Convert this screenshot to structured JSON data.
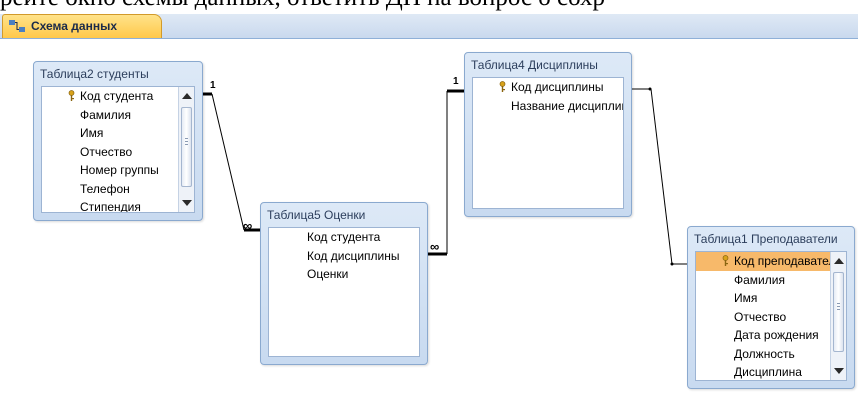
{
  "background_text": "рейте окно схемы данных, ответить ДП на вопрос о сохр",
  "tab": {
    "label": "Схема данных",
    "icon": "relationships-icon",
    "color": "#ffc84a"
  },
  "tables": [
    {
      "title": "Таблица2 студенты",
      "fields": [
        "Код студента",
        "Фамилия",
        "Имя",
        "Отчество",
        "Номер группы",
        "Телефон",
        "Стипендия"
      ],
      "key_field_index": 0
    },
    {
      "title": "Таблица5 Оценки",
      "fields": [
        "Код студента",
        "Код дисциплины",
        "Оценки"
      ]
    },
    {
      "title": "Таблица4 Дисциплины",
      "fields": [
        "Код дисциплины",
        "Название дисциплины"
      ],
      "key_field_index": 0
    },
    {
      "title": "Таблица1 Преподаватели",
      "fields": [
        "Код преподавателя",
        "Фамилия",
        "Имя",
        "Отчество",
        "Дата рождения",
        "Должность",
        "Дисциплина"
      ],
      "key_field_index": 0,
      "selected_field_index": 0
    }
  ],
  "relationships": [
    {
      "from": "Таблица2 студенты",
      "to": "Таблица5 Оценки",
      "one_label": "1",
      "many_label": "∞"
    },
    {
      "from": "Таблица4 Дисциплины",
      "to": "Таблица5 Оценки",
      "one_label": "1",
      "many_label": "∞"
    },
    {
      "from": "Таблица4 Дисциплины",
      "to": "Таблица1 Преподаватели"
    }
  ],
  "colors": {
    "selected_field": "#f7b96a",
    "table_header": "#c8daf0",
    "tab_bar": "#c9d9ee"
  }
}
